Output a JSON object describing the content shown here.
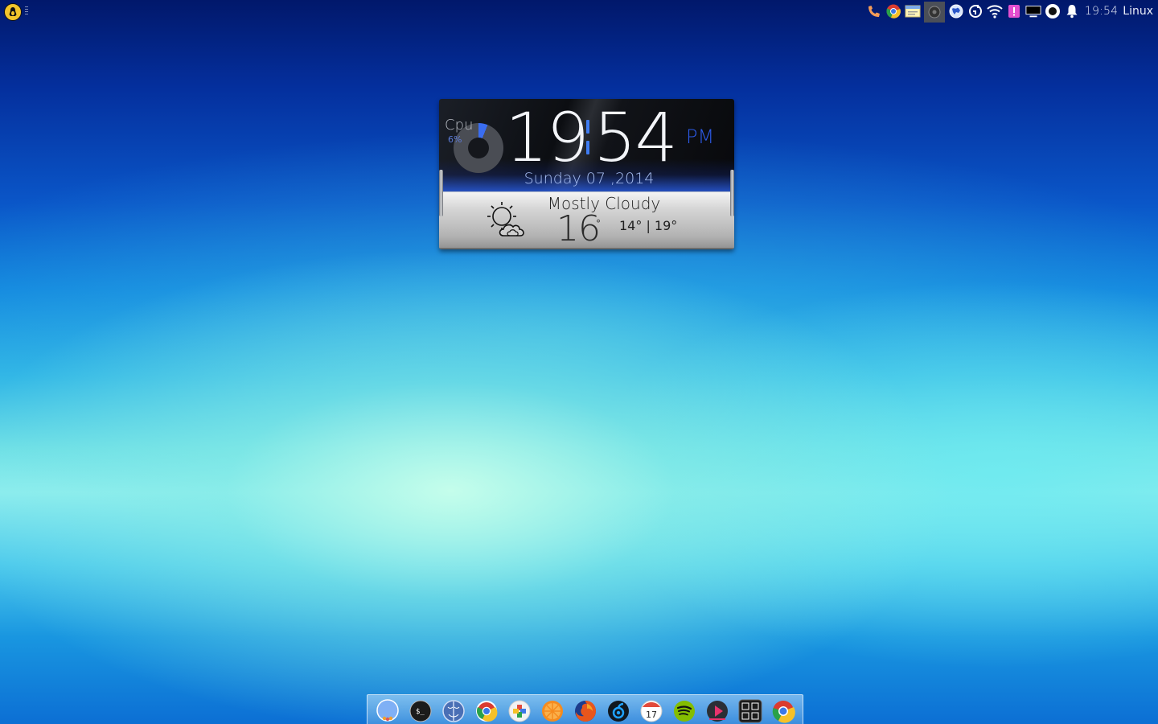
{
  "top_panel": {
    "menu_icon": "linux-penguin-icon",
    "tray_icons": [
      "phone-icon",
      "chrome-icon",
      "notes-icon",
      "disc-icon",
      "globe-icon",
      "sync-icon",
      "wifi-icon",
      "alert-icon",
      "display-icon",
      "record-icon",
      "bell-icon"
    ],
    "clock": "19:54",
    "user": "Linux"
  },
  "widget": {
    "cpu": {
      "label": "Cpu",
      "value": "6%",
      "percent": 6,
      "color": "#3a6df0"
    },
    "time": {
      "hours": "19",
      "minutes": "54",
      "ampm": "PM"
    },
    "date": "Sunday 07 ,2014",
    "weather": {
      "icon": "sun-cloud-icon",
      "condition": "Mostly Cloudy",
      "temperature": "16",
      "degree_symbol": "°",
      "range": "14° | 19°"
    }
  },
  "dock": {
    "items": [
      "finder-bubble-icon",
      "terminal-icon",
      "file-manager-icon",
      "chrome-icon",
      "plus-app-icon",
      "orange-slice-icon",
      "firefox-icon",
      "steam-icon",
      "calendar-icon",
      "spotify-icon",
      "media-player-icon",
      "app-grid-icon",
      "chrome-browser-icon"
    ],
    "calendar_day": "17"
  }
}
